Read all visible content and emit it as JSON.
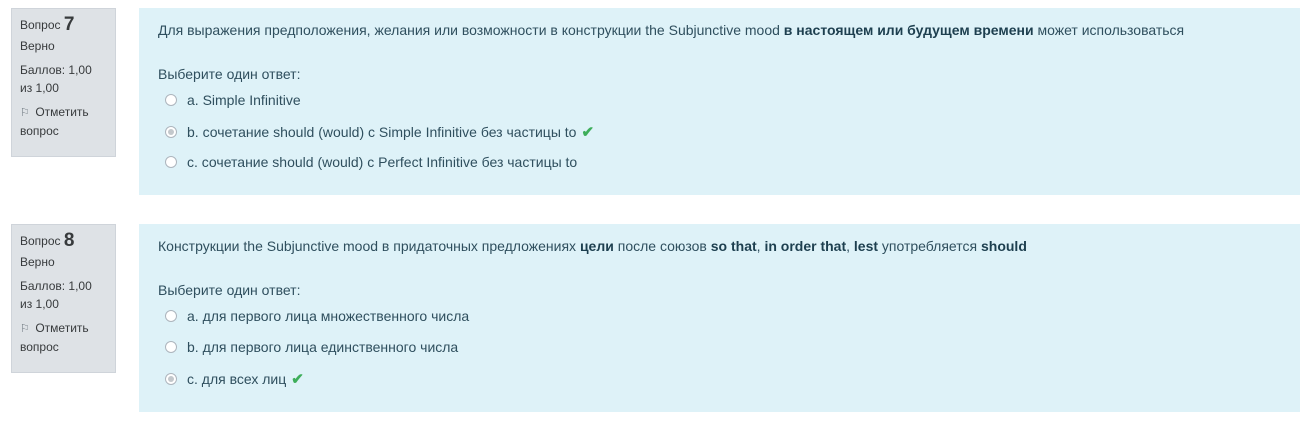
{
  "questions": [
    {
      "label": "Вопрос",
      "number": "7",
      "state": "Верно",
      "grade": "Баллов: 1,00 из 1,00",
      "flag_label": "Отметить вопрос",
      "text_parts": [
        "Для выражения предположения, желания или возможности в конструкции the Subjunctive mood ",
        "в настоящем или будущем времени",
        " может использоваться"
      ],
      "prompt": "Выберите один ответ:",
      "answers": [
        {
          "label": "a. Simple Infinitive",
          "checked": false,
          "correct": false
        },
        {
          "label": "b. сочетание should (would) с Simple Infinitive без частицы to",
          "checked": true,
          "correct": true
        },
        {
          "label": "c. сочетание should (would) с Perfect Infinitive без частицы to",
          "checked": false,
          "correct": false
        }
      ]
    },
    {
      "label": "Вопрос",
      "number": "8",
      "state": "Верно",
      "grade": "Баллов: 1,00 из 1,00",
      "flag_label": "Отметить вопрос",
      "text_parts": [
        "Конструкции the Subjunctive mood в придаточных предложениях ",
        "цели",
        " после союзов ",
        "so that",
        ", ",
        "in order that",
        ", ",
        "lest",
        " употребляется ",
        "should"
      ],
      "prompt": "Выберите один ответ:",
      "answers": [
        {
          "label": "a. для первого лица множественного числа",
          "checked": false,
          "correct": false
        },
        {
          "label": "b. для первого лица единственного числа",
          "checked": false,
          "correct": false
        },
        {
          "label": "c. для всех лиц",
          "checked": true,
          "correct": true
        }
      ]
    }
  ],
  "colors": {
    "info_bg": "#dee2e6",
    "content_bg": "#def2f8",
    "correct": "#3dae5a"
  }
}
